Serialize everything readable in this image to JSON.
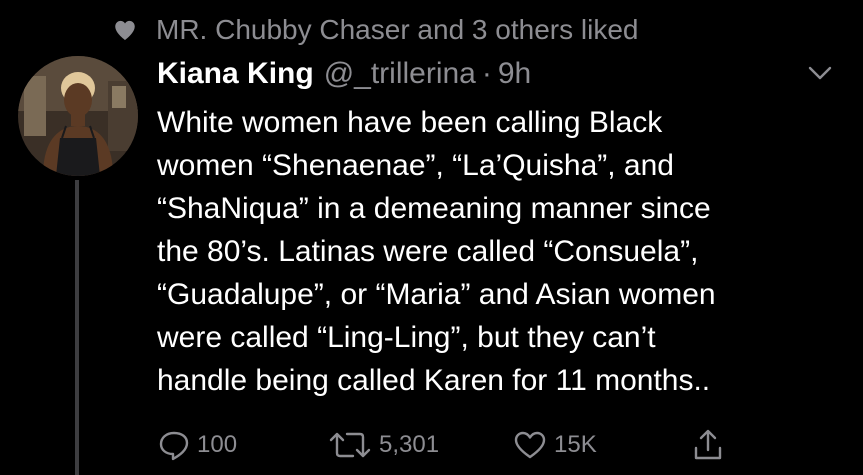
{
  "social_context": {
    "icon": "heart-icon",
    "text": "MR. Chubby Chaser and 3 others liked"
  },
  "tweet": {
    "author_name": "Kiana King",
    "author_handle": "@_trillerina",
    "separator": "·",
    "time": "9h",
    "text_lines": [
      "White women have been calling Black",
      "women “Shenaenae”, “La’Quisha”, and",
      "“ShaNiqua” in a demeaning manner since",
      "the 80’s. Latinas were called “Consuela”,",
      "“Guadalupe”, or “Maria” and Asian women",
      "were called “Ling-Ling”, but they can’t",
      "handle being called Karen for 11 months.."
    ],
    "replies": "100",
    "retweets": "5,301",
    "likes": "15K"
  },
  "colors": {
    "background": "#000000",
    "primary_text": "#ffffff",
    "secondary_text": "#8d8d92",
    "thread_line": "#3d3d40"
  },
  "icons": {
    "social_context": "heart-icon",
    "menu": "chevron-down-icon",
    "reply": "reply-icon",
    "retweet": "retweet-icon",
    "like": "like-icon",
    "share": "share-icon"
  }
}
